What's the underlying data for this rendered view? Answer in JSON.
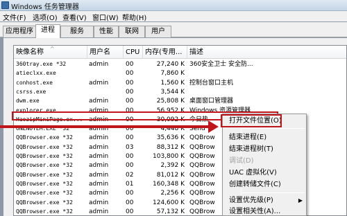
{
  "window": {
    "title": "Windows 任务管理器"
  },
  "menu": [
    "文件(F)",
    "选项(O)",
    "查看(V)",
    "窗口(W)",
    "帮助(H)"
  ],
  "tabs": [
    "应用程序",
    "进程",
    "服务",
    "性能",
    "联网",
    "用户"
  ],
  "columns": {
    "name": "映像名称",
    "user": "用户名",
    "cpu": "CPU",
    "mem": "内存(专用...",
    "desc": "描述"
  },
  "rows": [
    {
      "name": "360tray.exe *32",
      "user": "admin",
      "cpu": "00",
      "mem": "27,240 K",
      "desc": "360安全卫士 安全防..."
    },
    {
      "name": "atieclxx.exe",
      "user": "",
      "cpu": "00",
      "mem": "7,860 K",
      "desc": ""
    },
    {
      "name": "conhost.exe",
      "user": "admin",
      "cpu": "00",
      "mem": "1,560 K",
      "desc": "控制台窗口主机"
    },
    {
      "name": "csrss.exe",
      "user": "",
      "cpu": "00",
      "mem": "3,544 K",
      "desc": ""
    },
    {
      "name": "dwm.exe",
      "user": "admin",
      "cpu": "00",
      "mem": "25,808 K",
      "desc": "桌面窗口管理器"
    },
    {
      "name": "explorer.exe",
      "user": "admin",
      "cpu": "00",
      "mem": "56,952 K",
      "desc": "Windows 资源管理器"
    },
    {
      "name": "HaozipMiniPage.ex...",
      "user": "admin",
      "cpu": "00",
      "mem": "30,092 K",
      "desc": "今日热"
    },
    {
      "name": "ONENOTEM.EXE *32",
      "user": "admin",
      "cpu": "00",
      "mem": "4,448 K",
      "desc": "Send"
    },
    {
      "name": "QQBrowser.exe *32",
      "user": "admin",
      "cpu": "00",
      "mem": "35,636 K",
      "desc": "QQBrow"
    },
    {
      "name": "QQBrowser.exe *32",
      "user": "admin",
      "cpu": "03",
      "mem": "88,312 K",
      "desc": "QQBrow"
    },
    {
      "name": "QQBrowser.exe *32",
      "user": "admin",
      "cpu": "00",
      "mem": "103,800 K",
      "desc": "QQBrow"
    },
    {
      "name": "QQBrowser.exe *32",
      "user": "admin",
      "cpu": "00",
      "mem": "2,392 K",
      "desc": "QQBrow"
    },
    {
      "name": "QQBrowser.exe *32",
      "user": "admin",
      "cpu": "02",
      "mem": "81,012 K",
      "desc": "QQBrow"
    },
    {
      "name": "QQBrowser.exe *32",
      "user": "admin",
      "cpu": "01",
      "mem": "160,348 K",
      "desc": "QQBrow"
    },
    {
      "name": "QQBrowser.exe *32",
      "user": "admin",
      "cpu": "00",
      "mem": "2,256 K",
      "desc": "QQBrow"
    },
    {
      "name": "QQBrowser.exe *32",
      "user": "admin",
      "cpu": "00",
      "mem": "124,600 K",
      "desc": "QQBrow"
    },
    {
      "name": "QQBrowser.exe *32",
      "user": "admin",
      "cpu": "00",
      "mem": "57,132 K",
      "desc": "QQBrow"
    }
  ],
  "context_menu": [
    {
      "label": "打开文件位置(O)",
      "disabled": false
    },
    {
      "label": "结束进程(E)",
      "disabled": false
    },
    {
      "label": "结束进程树(T)",
      "disabled": false
    },
    {
      "label": "调试(D)",
      "disabled": true
    },
    {
      "label": "UAC 虚拟化(V)",
      "disabled": false
    },
    {
      "label": "创建转储文件(C)",
      "disabled": false
    },
    {
      "label": "设置优先级(P)",
      "disabled": false
    },
    {
      "label": "设置相关性(A)...",
      "disabled": false
    }
  ],
  "colors": {
    "highlight": "#c0151b"
  }
}
